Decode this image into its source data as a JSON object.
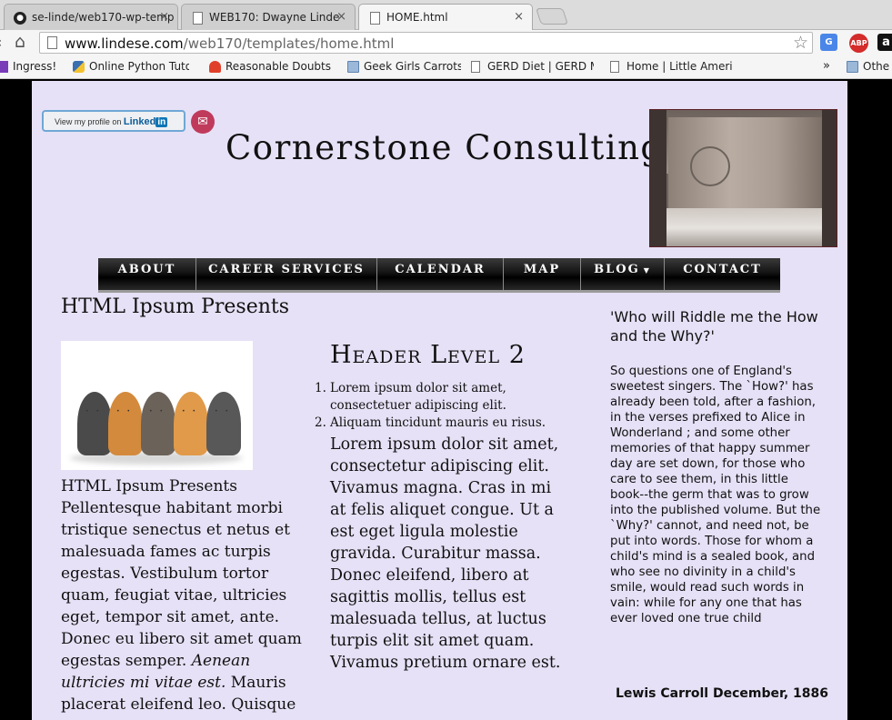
{
  "browser": {
    "tabs": [
      {
        "label": "se-linde/web170-wp-temp",
        "icon": "github-icon",
        "active": false
      },
      {
        "label": "WEB170: Dwayne Linde",
        "icon": "document-icon",
        "active": false
      },
      {
        "label": "HOME.html",
        "icon": "document-icon",
        "active": true
      }
    ],
    "close_glyph": "×",
    "url_host": "www.lindese.com",
    "url_path": "/web170/templates/home.html",
    "extensions": [
      "G",
      "ABP",
      "a"
    ],
    "bookmarks": [
      {
        "label": "Ingress!",
        "icon": "grid-icon"
      },
      {
        "label": "Online Python Tutor",
        "icon": "python-icon"
      },
      {
        "label": "Reasonable Doubts P",
        "icon": "podcast-icon"
      },
      {
        "label": "Geek Girls Carrots",
        "icon": "folder-icon"
      },
      {
        "label": "GERD Diet | GERD M",
        "icon": "document-icon"
      },
      {
        "label": "Home | Little Americ",
        "icon": "document-icon"
      }
    ],
    "bookmarks_overflow": "»",
    "other_bookmarks": "Othe"
  },
  "header": {
    "linkedin_prefix": "View my profile on",
    "linkedin_brand": "Linked",
    "linkedin_in": "in",
    "site_title": "Cornerstone Consulting"
  },
  "nav": {
    "items": [
      {
        "label": "ABOUT",
        "has_dropdown": false
      },
      {
        "label": "CAREER SERVICES",
        "has_dropdown": false
      },
      {
        "label": "CALENDAR",
        "has_dropdown": false
      },
      {
        "label": "MAP",
        "has_dropdown": false
      },
      {
        "label": "BLOG",
        "has_dropdown": true
      },
      {
        "label": "CONTACT",
        "has_dropdown": false
      }
    ]
  },
  "left_column": {
    "title": "HTML Ipsum Presents",
    "body_intro": "HTML Ipsum Presents Pellentesque habitant morbi tristique senectus et netus et malesuada fames ac turpis egestas. Vestibulum tortor quam, feugiat vitae, ultricies eget, tempor sit amet, ante. Donec eu libero sit amet quam egestas semper.",
    "body_italic": "Aenean ultricies mi vitae est.",
    "body_tail": "Mauris placerat eleifend leo. Quisque"
  },
  "middle_column": {
    "heading": "Header Level 2",
    "list": [
      "Lorem ipsum dolor sit amet, consectetuer adipiscing elit.",
      "Aliquam tincidunt mauris eu risus."
    ],
    "paragraph": "Lorem ipsum dolor sit amet, consectetur adipiscing elit. Vivamus magna. Cras in mi at felis aliquet congue. Ut a est eget ligula molestie gravida. Curabitur massa. Donec eleifend, libero at sagittis mollis, tellus est malesuada tellus, at luctus turpis elit sit amet quam. Vivamus pretium ornare est."
  },
  "right_column": {
    "quote_title": "'Who will Riddle me the How and the Why?'",
    "quote_body": "So questions one of England's sweetest singers. The `How?' has already been told, after a fashion, in the verses prefixed to Alice in Wonderland ; and some other memories of that happy summer day are set down, for those who care to see them, in this little book--the germ that was to grow into the published volume. But the `Why?' cannot, and need not, be put into words. Those for whom a child's mind is a sealed book, and who see no divinity in a child's smile, would read such words in vain: while for any one that has ever loved one true child",
    "attribution": "Lewis Carroll December, 1886"
  }
}
